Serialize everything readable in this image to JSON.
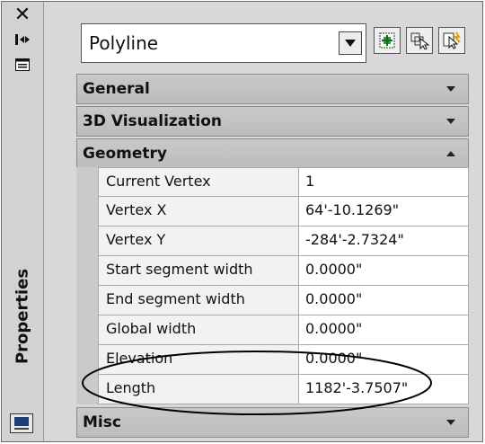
{
  "palette": {
    "title": "Properties",
    "close_icon": "close-icon",
    "autohide_icon": "autohide-icon",
    "properties_menu_icon": "properties-menu-icon",
    "bottom_icon": "properties-window-icon"
  },
  "selector": {
    "value": "Polyline",
    "tools": [
      "toggle-pickadd-icon",
      "select-objects-icon",
      "quick-select-icon"
    ]
  },
  "sections": {
    "general": "General",
    "visualization": "3D Visualization",
    "geometry": "Geometry",
    "misc": "Misc"
  },
  "geometry_rows": [
    {
      "name": "Current Vertex",
      "value": "1"
    },
    {
      "name": "Vertex X",
      "value": "64'-10.1269\""
    },
    {
      "name": "Vertex Y",
      "value": "-284'-2.7324\""
    },
    {
      "name": "Start segment width",
      "value": "0.0000\""
    },
    {
      "name": "End segment width",
      "value": "0.0000\""
    },
    {
      "name": "Global width",
      "value": "0.0000\""
    },
    {
      "name": "Elevation",
      "value": "0.0000\""
    },
    {
      "name": "Length",
      "value": "1182'-3.7507\""
    }
  ],
  "colors": {
    "panel_bg": "#d8d8d8",
    "section_bg": "#c4c4c4",
    "highlight_ellipse": "#000000"
  }
}
